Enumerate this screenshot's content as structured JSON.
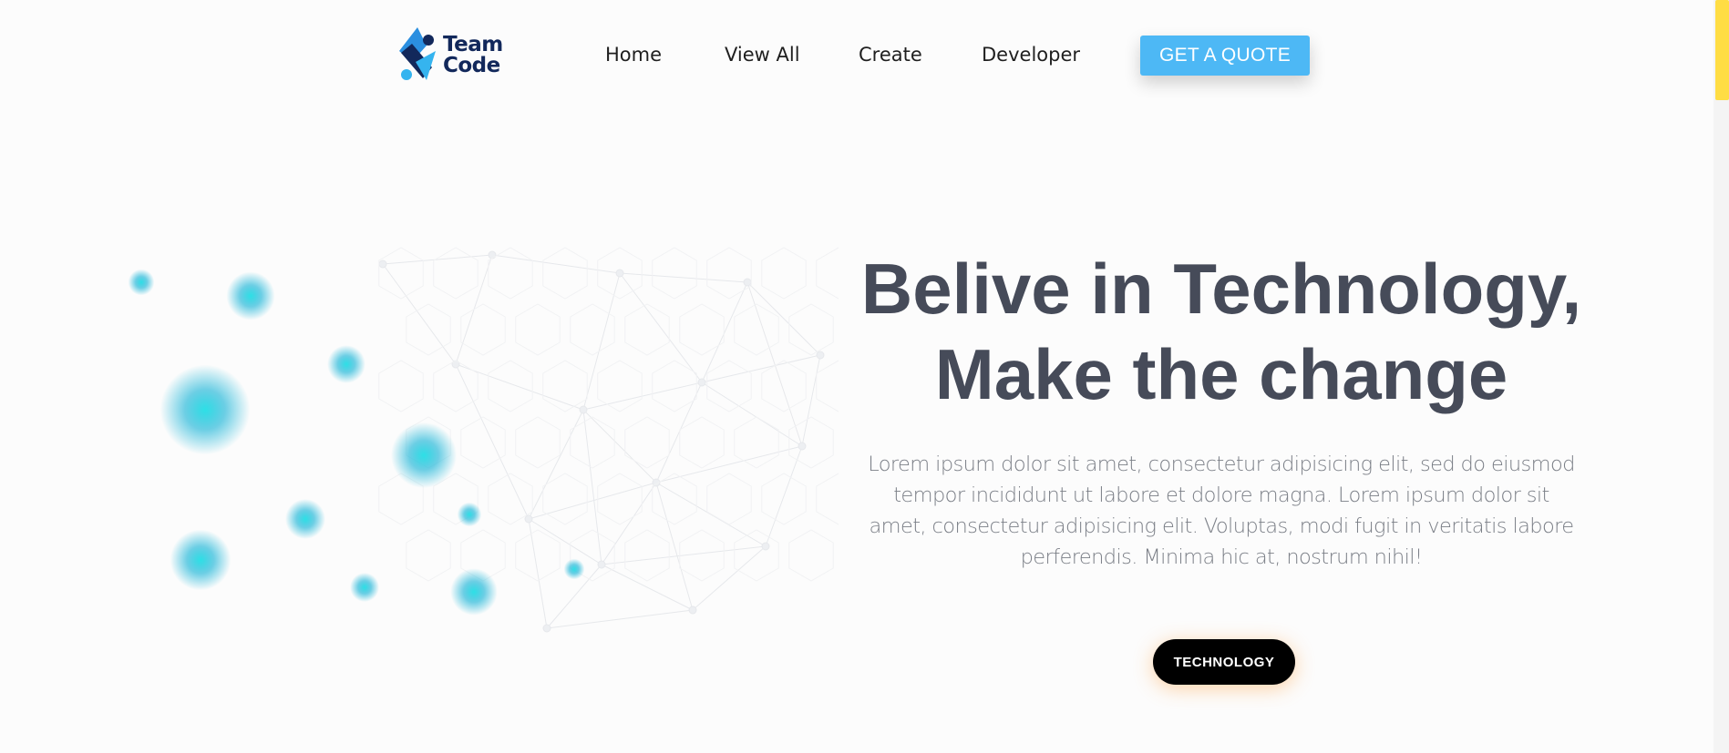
{
  "brand": {
    "line1": "Team",
    "line2": "Code",
    "colors": {
      "dark": "#12285b",
      "blue": "#2b8fe0",
      "cyan": "#35b4ef"
    }
  },
  "nav": {
    "items": [
      "Home",
      "View All",
      "Create",
      "Developer"
    ],
    "cta_label": "GET A QUOTE"
  },
  "hero": {
    "title_line1": "Belive in Technology,",
    "title_line2": "Make the change",
    "description": "Lorem ipsum dolor sit amet, consectetur adipisicing elit, sed do eiusmod tempor incididunt ut labore et dolore magna. Lorem ipsum dolor sit amet, consectetur adipisicing elit. Voluptas, modi fugit in veritatis labore perferendis. Minima hic at, nostrum nihil!",
    "button_label": "TECHNOLOGY",
    "image_icon": "abstract-stars-illustration"
  },
  "colors": {
    "accent": "#4db8f5",
    "title": "#464b59",
    "body_text": "#7b7f87",
    "scrollbar": "#ffdd44"
  }
}
